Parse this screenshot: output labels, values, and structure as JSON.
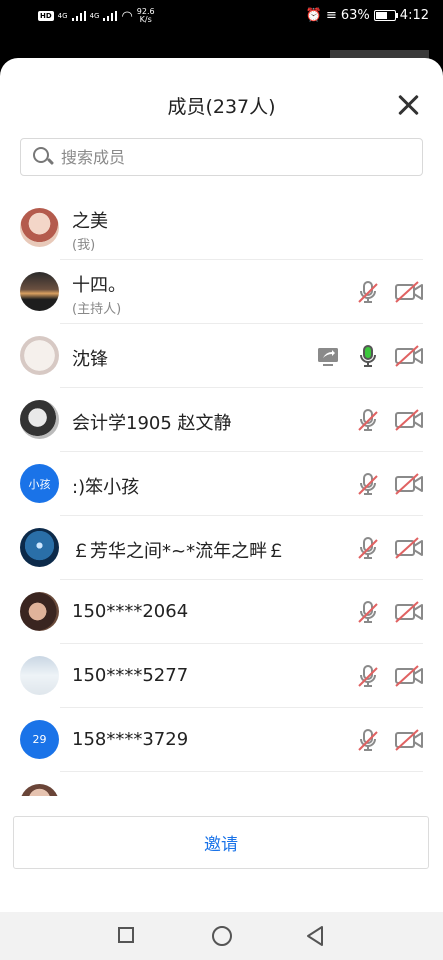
{
  "status_bar": {
    "chip_label": "HD",
    "network_1": "4G",
    "network_2": "4G",
    "speed_value": "92.6",
    "speed_unit": "K/s",
    "battery_percent": "63%",
    "battery_level": 0.63,
    "time": "4:12"
  },
  "sheet": {
    "title": "成员(237人)",
    "search_placeholder": "搜索成员",
    "invite_label": "邀请"
  },
  "members": [
    {
      "name": "之美",
      "sub": "(我)",
      "avatar": "photo-girl",
      "mic": "none",
      "cam": "none",
      "share": false
    },
    {
      "name": "十四。",
      "sub": "(主持人)",
      "avatar": "photo-sunset",
      "mic": "muted",
      "cam": "off",
      "share": false
    },
    {
      "name": "沈锋",
      "sub": "",
      "avatar": "photo-calligraphy",
      "mic": "active",
      "cam": "off",
      "share": true
    },
    {
      "name": " 会计学1905 赵文静",
      "sub": "",
      "avatar": "photo-bw",
      "mic": "muted",
      "cam": "off",
      "share": false
    },
    {
      "name": ":)笨小孩",
      "sub": "",
      "avatar_text": "小孩",
      "avatar_color": "#1a73e8",
      "mic": "muted",
      "cam": "off",
      "share": false
    },
    {
      "name": "￡芳华之间*~*流年之畔￡",
      "sub": "",
      "avatar": "photo-star",
      "mic": "muted",
      "cam": "off",
      "share": false
    },
    {
      "name": "150****2064",
      "sub": "",
      "avatar": "photo-selfie",
      "mic": "muted",
      "cam": "off",
      "share": false
    },
    {
      "name": "150****5277",
      "sub": "",
      "avatar": "photo-snow",
      "mic": "muted",
      "cam": "off",
      "share": false
    },
    {
      "name": "158****3729",
      "sub": "",
      "avatar_text": "29",
      "avatar_color": "#1a73e8",
      "mic": "muted",
      "cam": "off",
      "share": false
    }
  ],
  "colors": {
    "accent": "#1a73e8",
    "muted_red": "#e06262",
    "mic_active": "#3cc63c",
    "icon_gray": "#8a8a8a"
  }
}
